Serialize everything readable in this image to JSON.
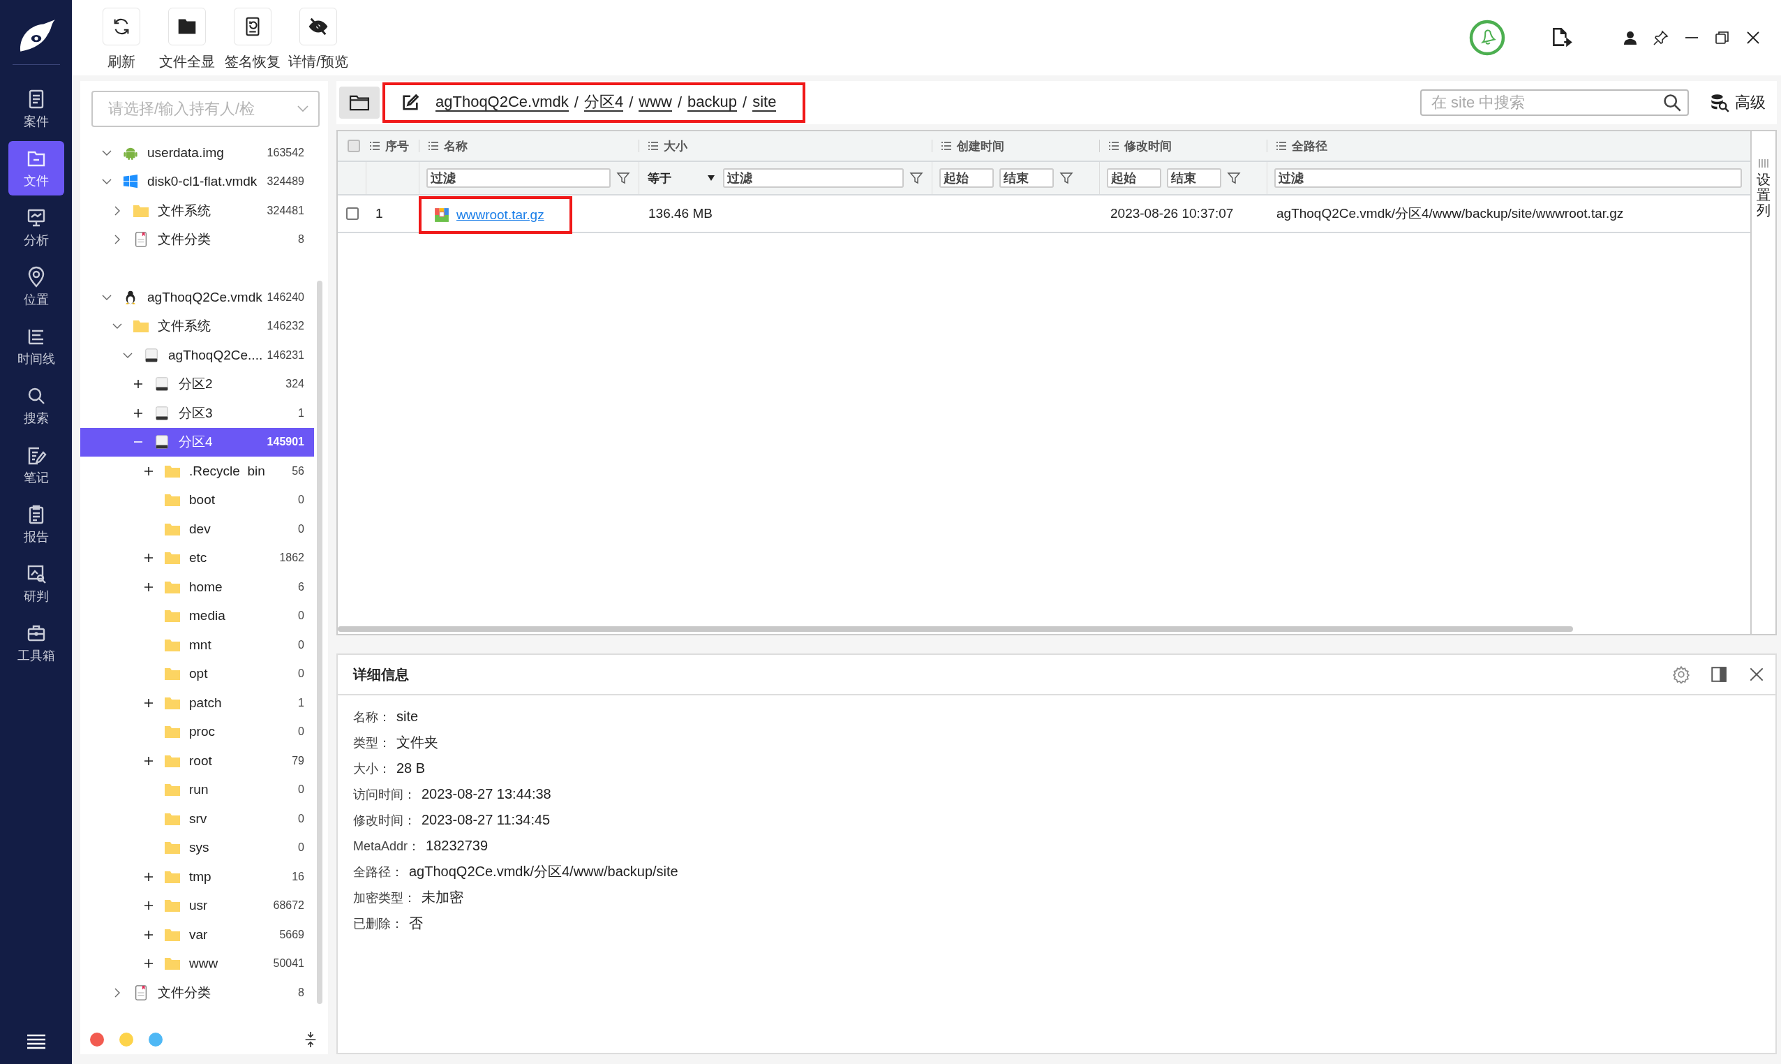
{
  "nav": {
    "items": [
      {
        "label": "案件",
        "kind": "case",
        "selected": false
      },
      {
        "label": "文件",
        "kind": "file",
        "selected": true
      },
      {
        "label": "分析",
        "kind": "analysis",
        "selected": false
      },
      {
        "label": "位置",
        "kind": "location",
        "selected": false
      },
      {
        "label": "时间线",
        "kind": "timeline",
        "selected": false
      },
      {
        "label": "搜索",
        "kind": "search",
        "selected": false
      },
      {
        "label": "笔记",
        "kind": "notes",
        "selected": false
      },
      {
        "label": "报告",
        "kind": "report",
        "selected": false
      },
      {
        "label": "研判",
        "kind": "judge",
        "selected": false
      },
      {
        "label": "工具箱",
        "kind": "toolbox",
        "selected": false
      }
    ]
  },
  "toolbar": [
    {
      "label": "刷新",
      "kind": "refresh"
    },
    {
      "label": "文件全显",
      "kind": "folder"
    },
    {
      "label": "签名恢复",
      "kind": "restore"
    },
    {
      "label": "详情/预览",
      "kind": "hide"
    }
  ],
  "tree": {
    "placeholder": "请选择/输入持有人/检",
    "nodes": [
      {
        "label": "userdata.img",
        "count": "163542",
        "kind": "android",
        "toggle": {
          "kind": "chevron",
          "expanded": true
        }
      },
      {
        "label": "disk0-cl1-flat.vmdk",
        "count": "324489",
        "kind": "windows",
        "toggle": {
          "kind": "chevron",
          "expanded": true
        },
        "children": [
          {
            "label": "文件系统",
            "count": "324481",
            "kind": "folder",
            "toggle": {
              "kind": "chevron",
              "expanded": false
            }
          },
          {
            "label": "文件分类",
            "count": "8",
            "kind": "doc",
            "toggle": {
              "kind": "chevron",
              "expanded": false
            }
          }
        ]
      },
      {
        "label": "agThoqQ2Ce.vmdk",
        "count": "146240",
        "kind": "linux",
        "toggle": {
          "kind": "chevron",
          "expanded": true
        },
        "children": [
          {
            "label": "文件系统",
            "count": "146232",
            "kind": "folder",
            "toggle": {
              "kind": "chevron",
              "expanded": true
            },
            "children": [
              {
                "label": "agThoqQ2Ce....",
                "count": "146231",
                "kind": "disk",
                "toggle": {
                  "kind": "chevron",
                  "expanded": true
                },
                "children": [
                  {
                    "label": "分区2",
                    "count": "324",
                    "kind": "disk",
                    "toggle": {
                      "kind": "plus",
                      "expanded": false
                    },
                    "selected": false
                  },
                  {
                    "label": "分区3",
                    "count": "1",
                    "kind": "disk",
                    "toggle": {
                      "kind": "plus",
                      "expanded": false
                    },
                    "selected": false
                  },
                  {
                    "label": "分区4",
                    "count": "145901",
                    "kind": "disk",
                    "toggle": {
                      "kind": "plus",
                      "expanded": true
                    },
                    "selected": true,
                    "children": [
                      {
                        "label": ".Recycle  bin",
                        "count": "56",
                        "kind": "folder",
                        "toggle": {
                          "kind": "plus",
                          "expanded": false
                        }
                      },
                      {
                        "label": "boot",
                        "count": "0",
                        "kind": "folder"
                      },
                      {
                        "label": "dev",
                        "count": "0",
                        "kind": "folder"
                      },
                      {
                        "label": "etc",
                        "count": "1862",
                        "kind": "folder",
                        "toggle": {
                          "kind": "plus",
                          "expanded": false
                        }
                      },
                      {
                        "label": "home",
                        "count": "6",
                        "kind": "folder",
                        "toggle": {
                          "kind": "plus",
                          "expanded": false
                        }
                      },
                      {
                        "label": "media",
                        "count": "0",
                        "kind": "folder"
                      },
                      {
                        "label": "mnt",
                        "count": "0",
                        "kind": "folder"
                      },
                      {
                        "label": "opt",
                        "count": "0",
                        "kind": "folder"
                      },
                      {
                        "label": "patch",
                        "count": "1",
                        "kind": "folder",
                        "toggle": {
                          "kind": "plus",
                          "expanded": false
                        }
                      },
                      {
                        "label": "proc",
                        "count": "0",
                        "kind": "folder"
                      },
                      {
                        "label": "root",
                        "count": "79",
                        "kind": "folder",
                        "toggle": {
                          "kind": "plus",
                          "expanded": false
                        }
                      },
                      {
                        "label": "run",
                        "count": "0",
                        "kind": "folder"
                      },
                      {
                        "label": "srv",
                        "count": "0",
                        "kind": "folder"
                      },
                      {
                        "label": "sys",
                        "count": "0",
                        "kind": "folder"
                      },
                      {
                        "label": "tmp",
                        "count": "16",
                        "kind": "folder",
                        "toggle": {
                          "kind": "plus",
                          "expanded": false
                        }
                      },
                      {
                        "label": "usr",
                        "count": "68672",
                        "kind": "folder",
                        "toggle": {
                          "kind": "plus",
                          "expanded": false
                        }
                      },
                      {
                        "label": "var",
                        "count": "5669",
                        "kind": "folder",
                        "toggle": {
                          "kind": "plus",
                          "expanded": false
                        }
                      },
                      {
                        "label": "www",
                        "count": "50041",
                        "kind": "folder",
                        "toggle": {
                          "kind": "plus",
                          "expanded": false
                        }
                      }
                    ]
                  }
                ]
              }
            ]
          },
          {
            "label": "文件分类",
            "count": "8",
            "kind": "doc",
            "toggle": {
              "kind": "chevron",
              "expanded": false
            }
          }
        ]
      }
    ]
  },
  "tags": [
    {
      "color": "#f25b50"
    },
    {
      "color": "#fdd34a"
    },
    {
      "color": "#4fb8f5"
    }
  ],
  "path_bar": {
    "highlighted": true,
    "separator": "/",
    "parts": [
      "agThoqQ2Ce.vmdk",
      "分区4",
      "www",
      "backup",
      "site"
    ]
  },
  "search": {
    "placeholder": "在 site 中搜索"
  },
  "advanced_button": "高级",
  "table": {
    "select_all": false,
    "columns": [
      {
        "label": "序号"
      },
      {
        "label": "名称"
      },
      {
        "label": "大小"
      },
      {
        "label": "创建时间"
      },
      {
        "label": "修改时间"
      },
      {
        "label": "全路径"
      }
    ],
    "filters": [
      {
        "kind": "none"
      },
      {
        "kind": "text",
        "placeholder": "过滤",
        "funnel": true
      },
      {
        "kind": "number",
        "operator": "等于",
        "placeholder": "过滤",
        "funnel": true
      },
      {
        "kind": "range",
        "fields": [
          {
            "placeholder": "起始"
          },
          {
            "placeholder": "结束"
          }
        ],
        "funnel": true
      },
      {
        "kind": "range",
        "fields": [
          {
            "placeholder": "起始"
          },
          {
            "placeholder": "结束"
          }
        ],
        "funnel": true
      },
      {
        "kind": "text",
        "placeholder": "过滤",
        "funnel": false
      }
    ],
    "rows": [
      {
        "checked": false,
        "index": "1",
        "name": "wwwroot.tar.gz",
        "highlighted": true,
        "size": "136.46 MB",
        "modified": "2023-08-26 10:37:07",
        "path": "agThoqQ2Ce.vmdk/分区4/www/backup/site/wwwroot.tar.gz"
      }
    ],
    "column_settings": "设置列"
  },
  "details": {
    "title": "详细信息",
    "fields": [
      {
        "label": "名称：",
        "value": "site"
      },
      {
        "label": "类型：",
        "value": "文件夹"
      },
      {
        "label": "大小：",
        "value": "28 B"
      },
      {
        "label": "访问时间：",
        "value": "2023-08-27 13:44:38"
      },
      {
        "label": "修改时间：",
        "value": "2023-08-27 11:34:45"
      },
      {
        "label": "MetaAddr：",
        "value": "18232739"
      },
      {
        "label": "全路径：",
        "value": "agThoqQ2Ce.vmdk/分区4/www/backup/site"
      },
      {
        "label": "加密类型：",
        "value": "未加密"
      },
      {
        "label": "已删除：",
        "value": "否"
      }
    ]
  }
}
